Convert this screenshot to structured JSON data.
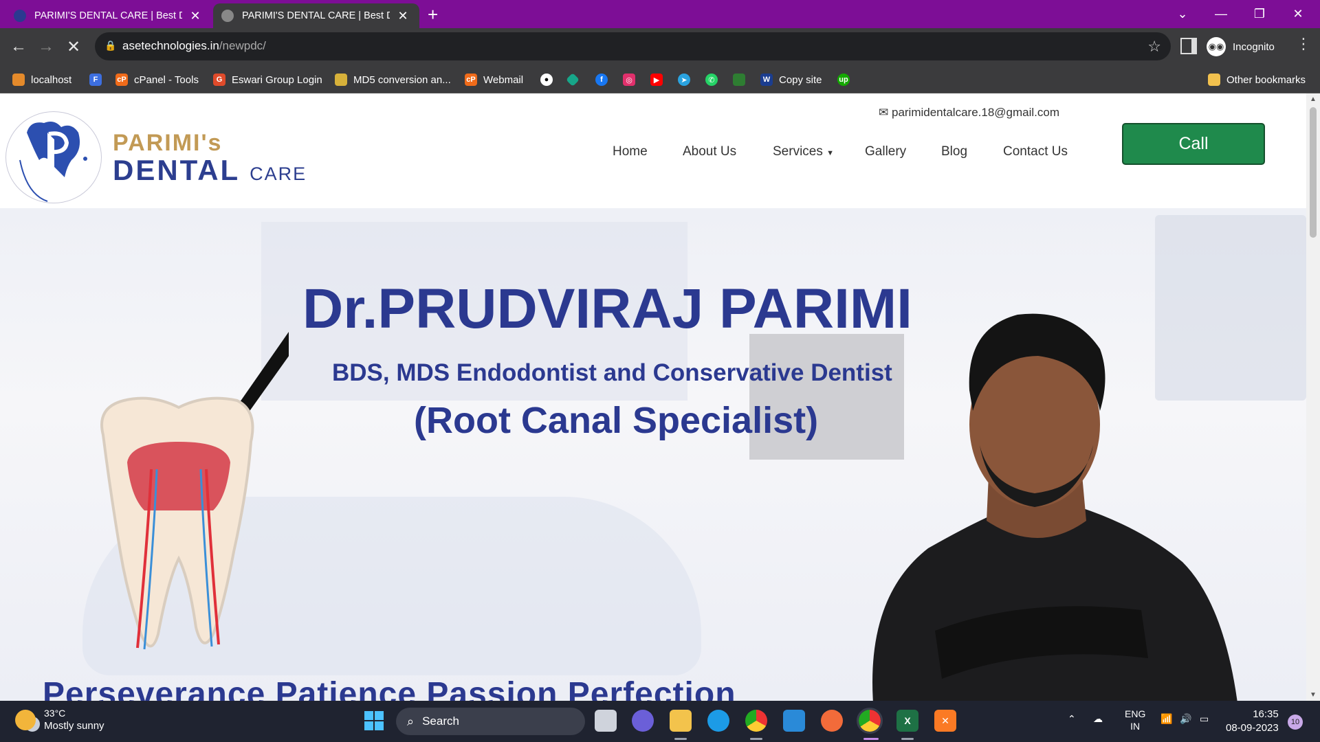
{
  "browser": {
    "tabs": [
      {
        "title": "PARIMI'S DENTAL CARE | Best De",
        "active": false
      },
      {
        "title": "PARIMI'S DENTAL CARE | Best De",
        "active": true
      }
    ],
    "new_tab": "+",
    "window_controls": {
      "list": "⌄",
      "minimize": "—",
      "restore": "❐",
      "close": "✕"
    },
    "nav": {
      "back": "←",
      "forward": "→",
      "stop": "✕"
    },
    "address": {
      "host": "asetechnologies.in",
      "path": "/newpdc/"
    },
    "bookmark_star": "☆",
    "incognito_label": "Incognito",
    "menu": "⋮",
    "bookmarks": [
      {
        "label": "localhost",
        "color": "#e48a2b"
      },
      {
        "label": "",
        "color": "#3d6fe0"
      },
      {
        "label": "cPanel - Tools",
        "color": "#f06b1a"
      },
      {
        "label": "Eswari Group Login",
        "color": "#e04b2b"
      },
      {
        "label": "MD5 conversion an...",
        "color": "#d7b13a"
      },
      {
        "label": "Webmail",
        "color": "#f06b1a"
      },
      {
        "label": "",
        "color": "#ffffff"
      },
      {
        "label": "",
        "color": "#17a689"
      },
      {
        "label": "",
        "color": "#1877f2"
      },
      {
        "label": "",
        "color": "#e1306c"
      },
      {
        "label": "",
        "color": "#ff0000"
      },
      {
        "label": "",
        "color": "#2aa3e0"
      },
      {
        "label": "",
        "color": "#25d366"
      },
      {
        "label": "",
        "color": "#2e7d32"
      },
      {
        "label": "Copy site",
        "color": "#1b3d8f"
      },
      {
        "label": "",
        "color": "#14a800"
      }
    ],
    "other_bookmarks": "Other bookmarks"
  },
  "site": {
    "logo": {
      "line1": "PARIMI's",
      "line2": "DENTAL",
      "line2_small": "CARE"
    },
    "email": "parimidentalcare.18@gmail.com",
    "nav": [
      "Home",
      "About Us",
      "Services",
      "Gallery",
      "Blog",
      "Contact Us"
    ],
    "call_label": "Call",
    "hero": {
      "name": "Dr.PRUDVIRAJ PARIMI",
      "degree": "BDS, MDS Endodontist and Conservative Dentist",
      "specialty": "(Root Canal Specialist)",
      "motto": "Perseverance  Patience  Passion  Perfection"
    },
    "colors": {
      "brand_blue": "#2b3990",
      "brand_gold": "#c29a55",
      "call_green": "#1f8a4c"
    }
  },
  "taskbar": {
    "weather_temp": "33°C",
    "weather_desc": "Mostly sunny",
    "search_label": "Search",
    "lang_top": "ENG",
    "lang_bottom": "IN",
    "time": "16:35",
    "date": "08-09-2023",
    "notifications": "10",
    "apps": [
      "windows-start",
      "task-view",
      "teams",
      "file-explorer",
      "edge",
      "chrome",
      "vscode",
      "postman",
      "chrome-incognito",
      "excel",
      "xampp"
    ]
  }
}
